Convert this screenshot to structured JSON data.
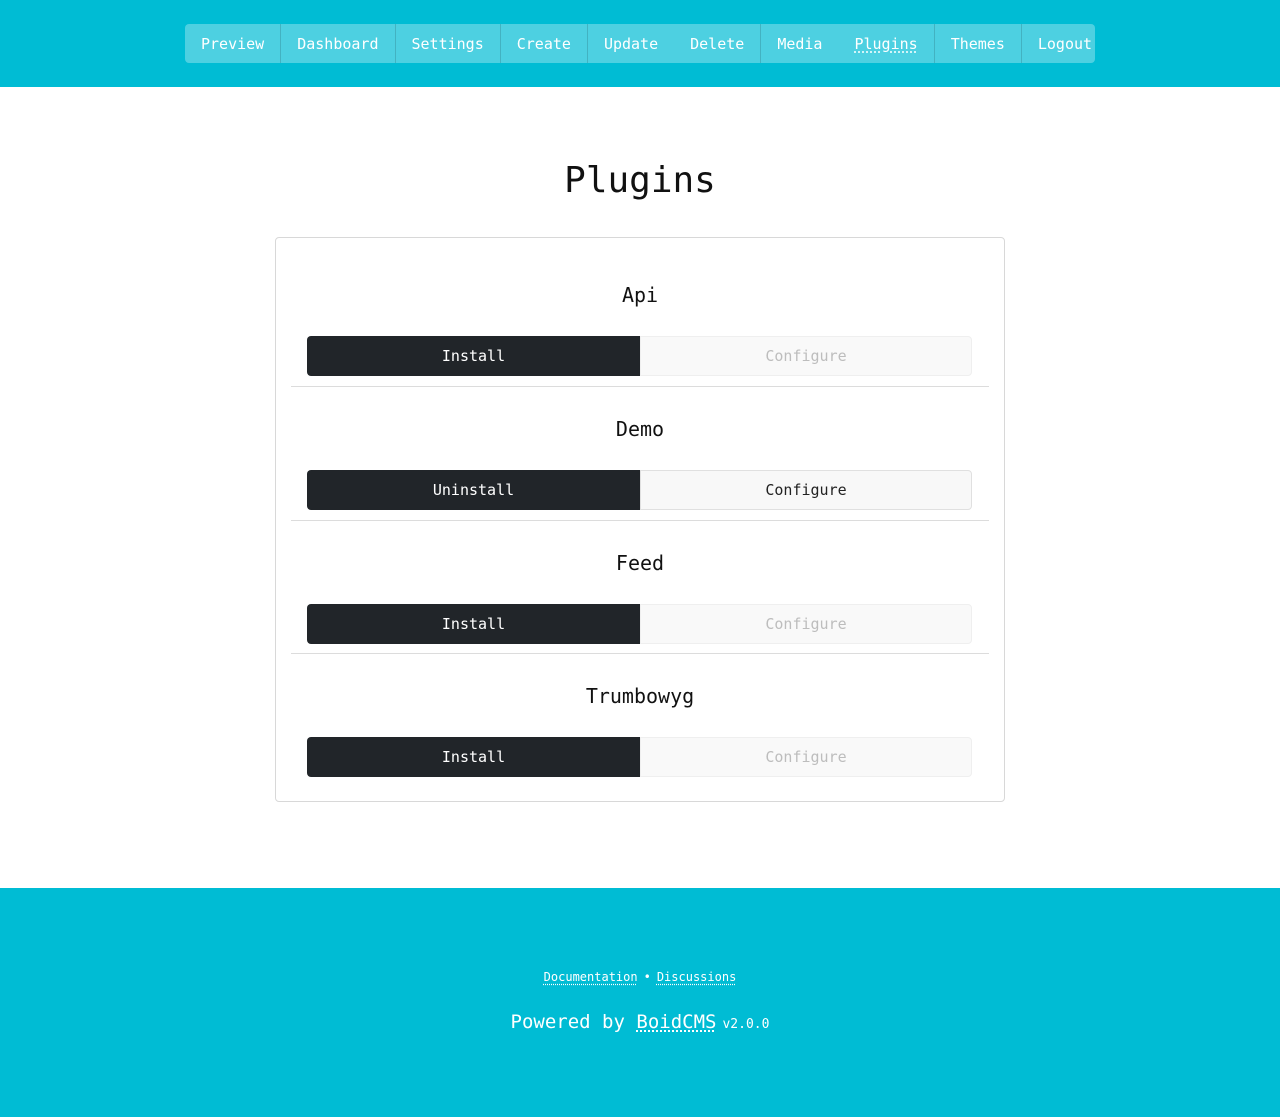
{
  "nav": {
    "groups": [
      [
        {
          "label": "Preview"
        }
      ],
      [
        {
          "label": "Dashboard"
        }
      ],
      [
        {
          "label": "Settings"
        }
      ],
      [
        {
          "label": "Create"
        }
      ],
      [
        {
          "label": "Update"
        },
        {
          "label": "Delete"
        }
      ],
      [
        {
          "label": "Media"
        },
        {
          "label": "Plugins",
          "active": true
        }
      ],
      [
        {
          "label": "Themes"
        }
      ],
      [
        {
          "label": "Logout"
        }
      ]
    ]
  },
  "page": {
    "title": "Plugins"
  },
  "plugins": [
    {
      "name": "Api",
      "action_label": "Install",
      "configure_label": "Configure",
      "configure_enabled": false
    },
    {
      "name": "Demo",
      "action_label": "Uninstall",
      "configure_label": "Configure",
      "configure_enabled": true
    },
    {
      "name": "Feed",
      "action_label": "Install",
      "configure_label": "Configure",
      "configure_enabled": false
    },
    {
      "name": "Trumbowyg",
      "action_label": "Install",
      "configure_label": "Configure",
      "configure_enabled": false
    }
  ],
  "footer": {
    "documentation_label": "Documentation",
    "separator": "•",
    "discussions_label": "Discussions",
    "powered_prefix": "Powered by",
    "brand": "BoidCMS",
    "version": "v2.0.0"
  },
  "colors": {
    "accent": "#00bcd4",
    "primary_button": "#212529"
  }
}
